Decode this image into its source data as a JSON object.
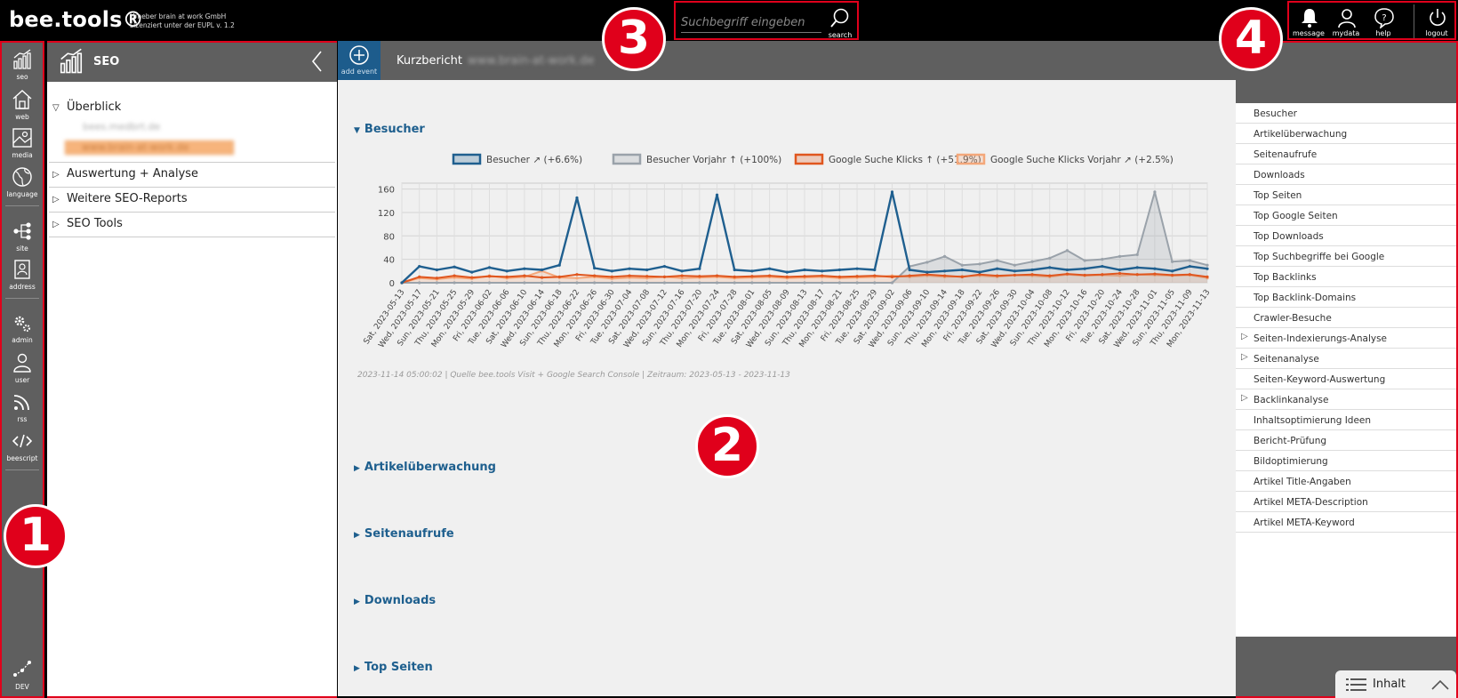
{
  "app": {
    "logo": "bee.tools®",
    "license_line1": "Urheber brain at work GmbH",
    "license_line2": "Lizenziert unter der EUPL v. 1.2"
  },
  "search": {
    "placeholder": "Suchbegriff eingeben",
    "button_label": "search"
  },
  "toolbar": {
    "message": "message",
    "mydata": "mydata",
    "help": "help",
    "logout": "logout"
  },
  "leftnav": [
    {
      "label": "seo",
      "icon": "chart-icon"
    },
    {
      "label": "web",
      "icon": "home-icon"
    },
    {
      "label": "media",
      "icon": "image-icon"
    },
    {
      "label": "language",
      "icon": "globe-icon"
    },
    {
      "label": "site",
      "icon": "sitemap-icon"
    },
    {
      "label": "address",
      "icon": "contact-icon"
    },
    {
      "label": "admin",
      "icon": "gears-icon"
    },
    {
      "label": "user",
      "icon": "user-icon"
    },
    {
      "label": "rss",
      "icon": "rss-icon"
    },
    {
      "label": "beescript",
      "icon": "code-icon"
    },
    {
      "label": "DEV",
      "icon": "dev-icon"
    }
  ],
  "tree": {
    "title": "SEO",
    "items": [
      {
        "label": "Überblick",
        "expanded": true
      },
      {
        "label": "Auswertung + Analyse",
        "expanded": false
      },
      {
        "label": "Weitere SEO-Reports",
        "expanded": false
      },
      {
        "label": "SEO Tools",
        "expanded": false
      }
    ],
    "sub_items": [
      "bees.medbrt.de",
      "www.brain-at-work.de"
    ]
  },
  "main": {
    "add_event_label": "add event",
    "title": "Kurzbericht",
    "title_domain": "www.brain-at-work.de",
    "sections": [
      "Besucher",
      "Artikelüberwachung",
      "Seitenaufrufe",
      "Downloads",
      "Top Seiten"
    ],
    "chart_caption": "2023-11-14 05:00:02 | Quelle bee.tools Visit + Google Search Console | Zeitraum: 2023-05-13 - 2023-11-13"
  },
  "chart_data": {
    "type": "line",
    "title": "",
    "xlabel": "",
    "ylabel": "",
    "ylim": [
      0,
      170
    ],
    "yticks": [
      0,
      40,
      80,
      120,
      160
    ],
    "grid": true,
    "legend_position": "top",
    "x": [
      "Sat, 2023-05-13",
      "Wed, 2023-05-17",
      "Sun, 2023-05-21",
      "Thu, 2023-05-25",
      "Mon, 2023-05-29",
      "Fri, 2023-06-02",
      "Tue, 2023-06-06",
      "Sat, 2023-06-10",
      "Wed, 2023-06-14",
      "Sun, 2023-06-18",
      "Thu, 2023-06-22",
      "Mon, 2023-06-26",
      "Fri, 2023-06-30",
      "Tue, 2023-07-04",
      "Sat, 2023-07-08",
      "Wed, 2023-07-12",
      "Sun, 2023-07-16",
      "Thu, 2023-07-20",
      "Mon, 2023-07-24",
      "Fri, 2023-07-28",
      "Tue, 2023-08-01",
      "Sat, 2023-08-05",
      "Wed, 2023-08-09",
      "Sun, 2023-08-13",
      "Thu, 2023-08-17",
      "Mon, 2023-08-21",
      "Fri, 2023-08-25",
      "Tue, 2023-08-29",
      "Sat, 2023-09-02",
      "Wed, 2023-09-06",
      "Sun, 2023-09-10",
      "Thu, 2023-09-14",
      "Mon, 2023-09-18",
      "Fri, 2023-09-22",
      "Tue, 2023-09-26",
      "Sat, 2023-09-30",
      "Wed, 2023-10-04",
      "Sun, 2023-10-08",
      "Thu, 2023-10-12",
      "Mon, 2023-10-16",
      "Fri, 2023-10-20",
      "Tue, 2023-10-24",
      "Sat, 2023-10-28",
      "Wed, 2023-11-01",
      "Sun, 2023-11-05",
      "Thu, 2023-11-09",
      "Mon, 2023-11-13"
    ],
    "series": [
      {
        "name": "Besucher ↗ (+6.6%)",
        "color": "#1f5f8f",
        "values": [
          0,
          28,
          22,
          27,
          18,
          26,
          20,
          24,
          22,
          30,
          145,
          25,
          20,
          24,
          22,
          28,
          20,
          24,
          150,
          22,
          20,
          24,
          18,
          22,
          20,
          22,
          24,
          22,
          155,
          22,
          18,
          20,
          22,
          18,
          24,
          20,
          22,
          26,
          22,
          24,
          28,
          22,
          26,
          24,
          20,
          28,
          24
        ]
      },
      {
        "name": "Besucher Vorjahr ↑ (+100%)",
        "color": "#9aa2aa",
        "values": [
          0,
          0,
          0,
          0,
          0,
          0,
          0,
          0,
          0,
          0,
          0,
          0,
          0,
          0,
          0,
          0,
          0,
          0,
          0,
          0,
          0,
          0,
          0,
          0,
          0,
          0,
          0,
          0,
          0,
          28,
          35,
          45,
          30,
          32,
          38,
          30,
          36,
          42,
          55,
          38,
          40,
          45,
          48,
          155,
          36,
          38,
          30
        ]
      },
      {
        "name": "Google Suche Klicks ↑ (+51.9%)",
        "color": "#e0561e",
        "values": [
          0,
          10,
          8,
          12,
          9,
          11,
          10,
          12,
          9,
          10,
          14,
          12,
          10,
          12,
          11,
          10,
          12,
          11,
          12,
          10,
          11,
          12,
          10,
          11,
          12,
          10,
          11,
          12,
          10,
          12,
          14,
          12,
          10,
          14,
          12,
          13,
          14,
          12,
          15,
          13,
          14,
          16,
          14,
          15,
          13,
          14,
          10
        ]
      },
      {
        "name": "Google Suche Klicks Vorjahr ↗ (+2.5%)",
        "color": "#f4a77a",
        "values": [
          0,
          8,
          6,
          9,
          7,
          12,
          8,
          10,
          20,
          9,
          8,
          10,
          7,
          9,
          8,
          10,
          8,
          9,
          10,
          8,
          9,
          10,
          8,
          9,
          10,
          8,
          9,
          10,
          12,
          10,
          12,
          10,
          11,
          12,
          10,
          13,
          12,
          10,
          14,
          12,
          13,
          12,
          14,
          13,
          12,
          13,
          8
        ]
      }
    ]
  },
  "rightpanel": {
    "links": [
      {
        "label": "Besucher",
        "expandable": false
      },
      {
        "label": "Artikelüberwachung",
        "expandable": false
      },
      {
        "label": "Seitenaufrufe",
        "expandable": false
      },
      {
        "label": "Downloads",
        "expandable": false
      },
      {
        "label": "Top Seiten",
        "expandable": false
      },
      {
        "label": "Top Google Seiten",
        "expandable": false
      },
      {
        "label": "Top Downloads",
        "expandable": false
      },
      {
        "label": "Top Suchbegriffe bei Google",
        "expandable": false
      },
      {
        "label": "Top Backlinks",
        "expandable": false
      },
      {
        "label": "Top Backlink-Domains",
        "expandable": false
      },
      {
        "label": "Crawler-Besuche",
        "expandable": false
      },
      {
        "label": "Seiten-Indexierungs-Analyse",
        "expandable": true
      },
      {
        "label": "Seitenanalyse",
        "expandable": true
      },
      {
        "label": "Seiten-Keyword-Auswertung",
        "expandable": false
      },
      {
        "label": "Backlinkanalyse",
        "expandable": true
      },
      {
        "label": "Inhaltsoptimierung Ideen",
        "expandable": false
      },
      {
        "label": "Bericht-Prüfung",
        "expandable": false
      },
      {
        "label": "Bildoptimierung",
        "expandable": false
      },
      {
        "label": "Artikel Title-Angaben",
        "expandable": false
      },
      {
        "label": "Artikel META-Description",
        "expandable": false
      },
      {
        "label": "Artikel META-Keyword",
        "expandable": false
      }
    ],
    "inhalt_label": "Inhalt"
  },
  "badges": [
    "1",
    "2",
    "3",
    "4"
  ]
}
